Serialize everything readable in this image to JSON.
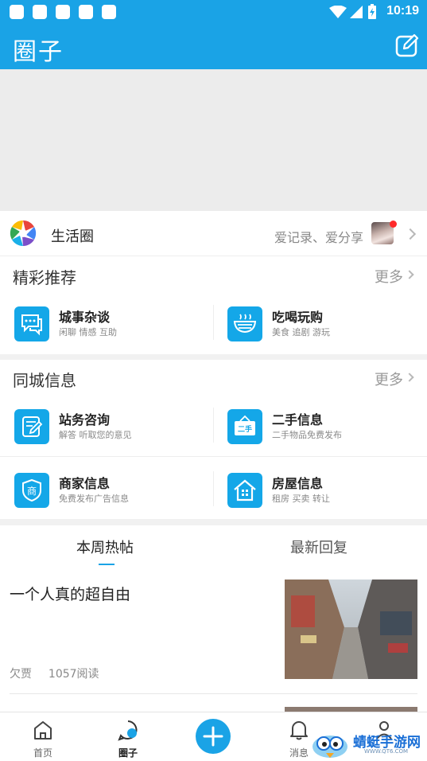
{
  "status_bar": {
    "time": "10:19"
  },
  "app_bar": {
    "title": "圈子",
    "edit_icon": "edit-icon"
  },
  "life_circle": {
    "title": "生活圈",
    "slogan": "爱记录、爱分享"
  },
  "featured": {
    "heading": "精彩推荐",
    "more": "更多",
    "items": [
      {
        "title": "城事杂谈",
        "subtitle": "闲聊 情感 互助",
        "icon": "chat-icon"
      },
      {
        "title": "吃喝玩购",
        "subtitle": "美食 追剧 游玩",
        "icon": "bowl-icon"
      }
    ]
  },
  "local_info": {
    "heading": "同城信息",
    "more": "更多",
    "items": [
      {
        "title": "站务咨询",
        "subtitle": "解答 听取您的意见",
        "icon": "notepad-icon"
      },
      {
        "title": "二手信息",
        "subtitle": "二手物品免费发布",
        "icon": "secondhand-sign-icon",
        "badge": "二手"
      },
      {
        "title": "商家信息",
        "subtitle": "免费发布广告信息",
        "icon": "shop-shield-icon",
        "badge": "商"
      },
      {
        "title": "房屋信息",
        "subtitle": "租房 买卖 转让",
        "icon": "house-icon"
      }
    ]
  },
  "tabs": [
    {
      "label": "本周热帖",
      "active": true
    },
    {
      "label": "最新回复",
      "active": false
    }
  ],
  "posts": [
    {
      "title": "一个人真的超自由",
      "author": "欠贾",
      "reads": "1057阅读"
    }
  ],
  "bottom_nav": [
    {
      "label": "首页",
      "icon": "home-icon",
      "active": false
    },
    {
      "label": "圈子",
      "icon": "circle-chat-icon",
      "active": true
    },
    {
      "label": "",
      "icon": "plus-icon",
      "active": false
    },
    {
      "label": "消息",
      "icon": "bell-icon",
      "active": false
    },
    {
      "label": "",
      "icon": "profile-icon",
      "active": false
    }
  ],
  "watermark": {
    "text": "蜻蜓手游网",
    "url": "WWW.QT6.COM"
  },
  "colors": {
    "primary": "#1aa3e6",
    "icon_bg": "#14a7e8"
  }
}
